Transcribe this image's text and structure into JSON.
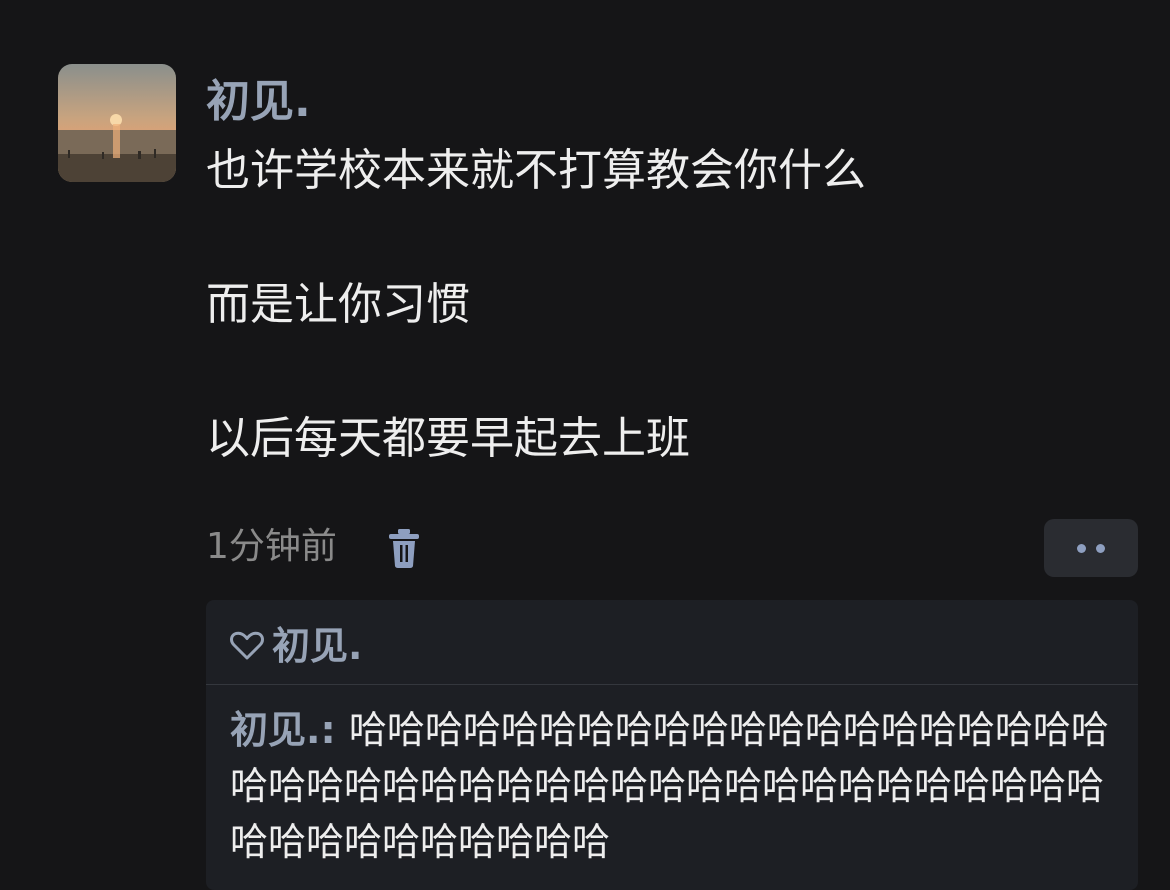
{
  "post": {
    "username": "初见.",
    "lines": [
      "也许学校本来就不打算教会你什么",
      "而是让你习惯",
      "以后每天都要早起去上班"
    ],
    "timestamp": "1分钟前"
  },
  "icons": {
    "avatar": "sunset-avatar",
    "delete": "trash-icon",
    "more": "more-dots-icon",
    "like": "heart-icon"
  },
  "replies": {
    "liked_by": "初见.",
    "comment": {
      "author": "初见.",
      "separator": ": ",
      "text": "哈哈哈哈哈哈哈哈哈哈哈哈哈哈哈哈哈哈哈哈哈哈哈哈哈哈哈哈哈哈哈哈哈哈哈哈哈哈哈哈哈哈哈哈哈哈哈哈哈哈哈哈哈"
    }
  },
  "colors": {
    "background": "#151517",
    "username": "#97a3b6",
    "text": "#eeeeee",
    "muted": "#8a8a8a",
    "panel": "#1d1f24",
    "accent_icon": "#8e9fc0"
  }
}
